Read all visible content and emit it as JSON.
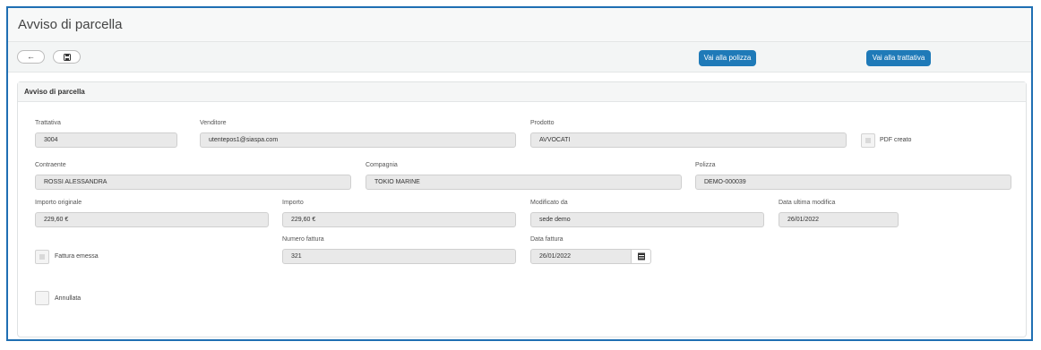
{
  "header": {
    "title": "Avviso di parcella"
  },
  "toolbar": {
    "back_icon": "←",
    "save_icon": "🖫",
    "goto_policy": "Vai alla polizza",
    "goto_deal": "Vai alla trattativa"
  },
  "panel": {
    "title": "Avviso di parcella"
  },
  "form": {
    "trattativa": {
      "label": "Trattativa",
      "value": "3004"
    },
    "venditore": {
      "label": "Venditore",
      "value": "utentepos1@siaspa.com"
    },
    "prodotto": {
      "label": "Prodotto",
      "value": "AVVOCATI"
    },
    "pdf_creato": {
      "label": "PDF creato",
      "checked": false
    },
    "contraente": {
      "label": "Contraente",
      "value": "ROSSI ALESSANDRA"
    },
    "compagnia": {
      "label": "Compagnia",
      "value": "TOKIO MARINE"
    },
    "polizza": {
      "label": "Polizza",
      "value": "DEMO-000039"
    },
    "importo_originale": {
      "label": "Importo originale",
      "value": "229,60 €"
    },
    "importo": {
      "label": "Importo",
      "value": "229,60 €"
    },
    "modificato_da": {
      "label": "Modificato da",
      "value": "sede demo"
    },
    "data_ultima_modifica": {
      "label": "Data ultima modifica",
      "value": "26/01/2022"
    },
    "fattura_emessa": {
      "label": "Fattura emessa",
      "checked": false
    },
    "numero_fattura": {
      "label": "Numero fattura",
      "value": "321"
    },
    "data_fattura": {
      "label": "Data fattura",
      "value": "26/01/2022"
    },
    "annullata": {
      "label": "Annullata",
      "checked": false
    }
  },
  "icons": {
    "back": "arrow-left-icon",
    "save": "floppy-disk-icon",
    "calendar": "calendar-icon"
  },
  "colors": {
    "frame_border": "#1f6fb3",
    "primary_button": "#1f7ab8",
    "input_bg": "#e9e9e9"
  }
}
